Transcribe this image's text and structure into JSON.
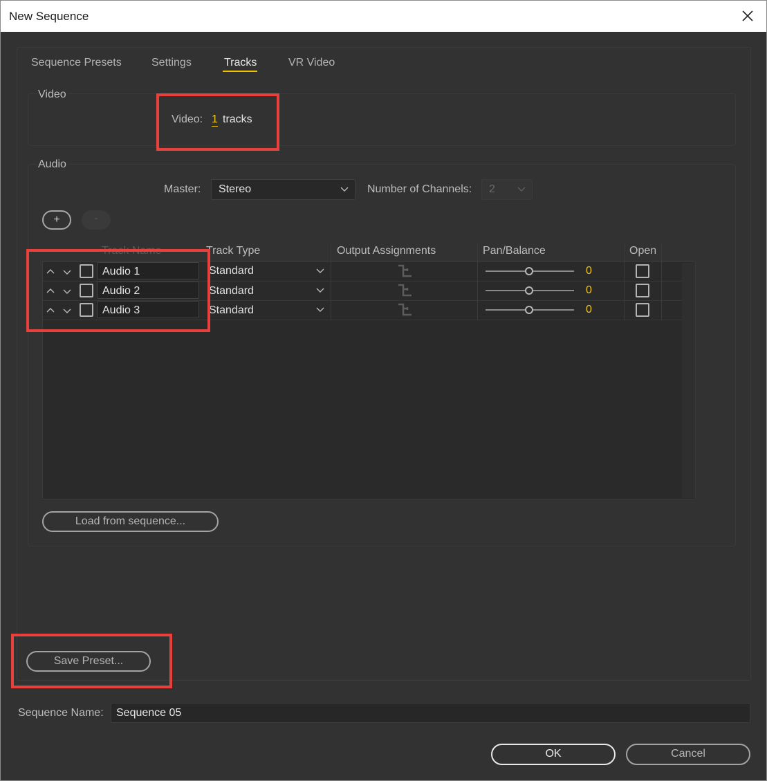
{
  "window": {
    "title": "New Sequence"
  },
  "tabs": [
    {
      "label": "Sequence Presets"
    },
    {
      "label": "Settings"
    },
    {
      "label": "Tracks"
    },
    {
      "label": "VR Video"
    }
  ],
  "video": {
    "group_label": "Video",
    "tracks_label": "Video:",
    "tracks_count": "1",
    "tracks_unit": "tracks"
  },
  "audio": {
    "group_label": "Audio",
    "master_label": "Master:",
    "master_value": "Stereo",
    "channels_label": "Number of Channels:",
    "channels_value": "2",
    "add_label": "+",
    "remove_label": "-",
    "columns": {
      "track_name": "Track Name",
      "track_type": "Track Type",
      "output": "Output Assignments",
      "pan": "Pan/Balance",
      "open": "Open"
    },
    "tracks": [
      {
        "name": "Audio 1",
        "type": "Standard",
        "pan": "0"
      },
      {
        "name": "Audio 2",
        "type": "Standard",
        "pan": "0"
      },
      {
        "name": "Audio 3",
        "type": "Standard",
        "pan": "0"
      }
    ],
    "load_button": "Load from sequence..."
  },
  "save_preset_button": "Save Preset...",
  "sequence_name": {
    "label": "Sequence Name:",
    "value": "Sequence 05"
  },
  "footer": {
    "ok": "OK",
    "cancel": "Cancel"
  },
  "colors": {
    "accent": "#f0c419",
    "highlight": "#e8413d",
    "background": "#323232"
  },
  "icons": {
    "close": "close-icon",
    "chevron": "chevron-down-icon",
    "move_up": "chevron-up-icon",
    "move_down": "chevron-down-icon",
    "output": "output-routing-icon"
  }
}
